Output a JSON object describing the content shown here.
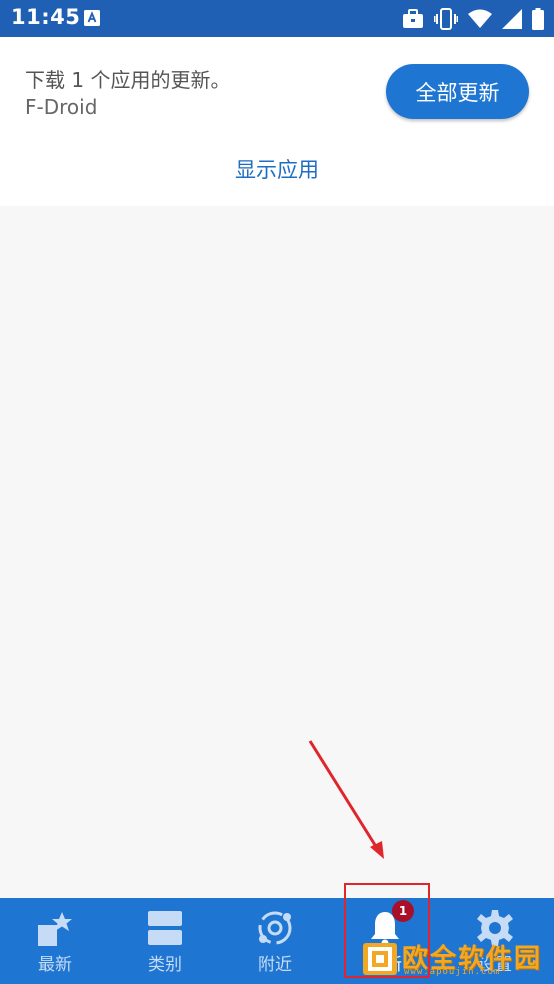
{
  "status_bar": {
    "time": "11:45",
    "icons": [
      "notification-a-icon",
      "briefcase-icon",
      "vibrate-icon",
      "wifi-icon",
      "cell-signal-icon",
      "battery-icon"
    ]
  },
  "header": {
    "update_message": "下载 1 个应用的更新。",
    "app_name": "F-Droid",
    "update_all_label": "全部更新",
    "show_apps_label": "显示应用"
  },
  "bottom_nav": {
    "items": [
      {
        "label": "最新",
        "icon": "latest-star-icon"
      },
      {
        "label": "类别",
        "icon": "categories-icon"
      },
      {
        "label": "附近",
        "icon": "nearby-icon"
      },
      {
        "label": "更新",
        "icon": "bell-icon",
        "badge": "1"
      },
      {
        "label": "设置",
        "icon": "gear-icon"
      }
    ],
    "active_index": 3
  },
  "watermark": {
    "text": "欧全软件园",
    "url": "www.apoujin.com"
  },
  "colors": {
    "primary": "#1f76d2",
    "status_bar": "#1f5fb4",
    "link": "#1f6dc3",
    "badge": "#a8102a",
    "annotation": "#e0262d"
  }
}
